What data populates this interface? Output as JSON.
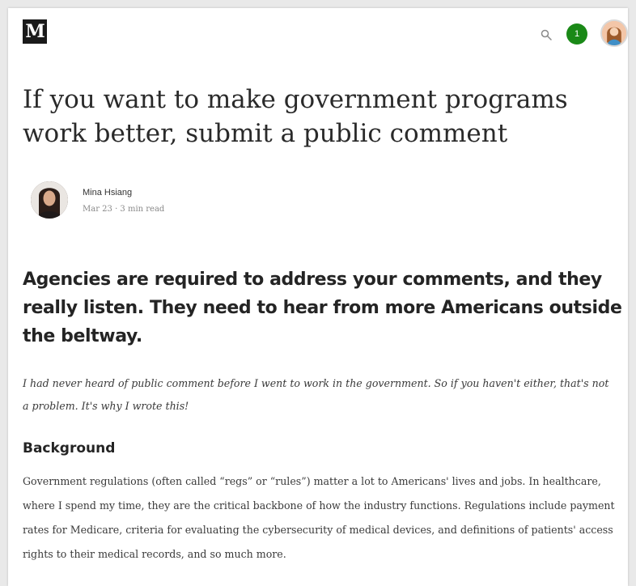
{
  "header": {
    "logo_text": "M",
    "notification_count": "1",
    "icons": [
      "search-icon",
      "user-avatar"
    ],
    "accent_color": "#1a8917"
  },
  "article": {
    "title": "If you want to make government programs work better, submit a public comment",
    "author": "Mina Hsiang",
    "meta": "Mar 23 · 3 min read",
    "subtitle": "Agencies are required to address your comments, and they really listen. They need to hear from more Americans outside the beltway.",
    "intro": "I had never heard of public comment before I went to work in the government. So if you haven't either, that's not a problem. It's why I wrote this!",
    "section_heading": "Background",
    "body": "Government regulations (often called “regs” or “rules”) matter a lot to Americans' lives and jobs. In healthcare, where I spend my time, they are the critical backbone of how the industry functions. Regulations include payment rates for Medicare, criteria for evaluating the cybersecurity of medical devices, and definitions of patients' access rights to their medical records, and so much more."
  }
}
